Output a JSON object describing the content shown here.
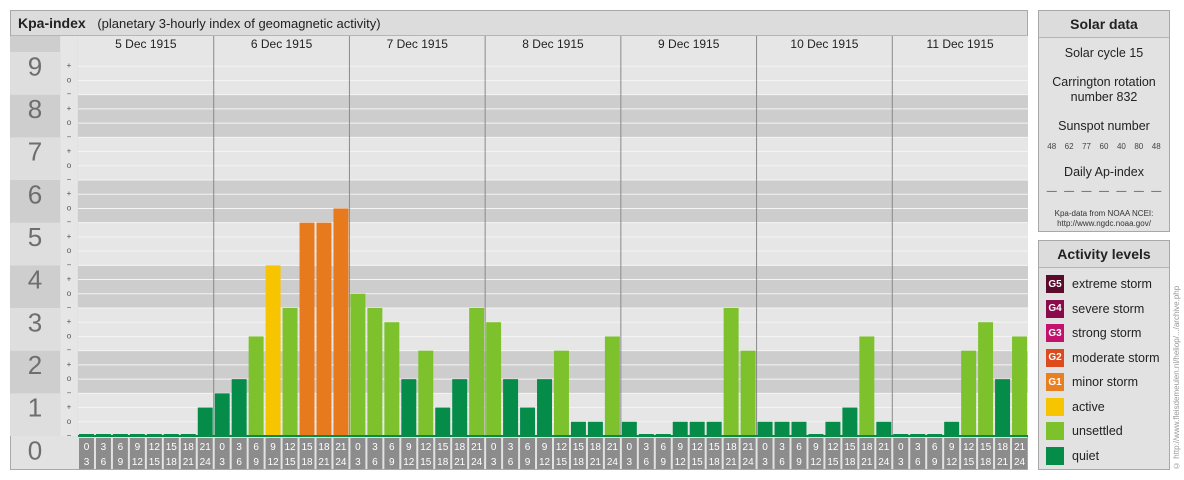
{
  "header": {
    "title": "Kpa-index",
    "subtitle": "(planetary 3-hourly index of geomagnetic activity)"
  },
  "chart_data": {
    "type": "bar",
    "ylim": [
      0,
      9
    ],
    "y_ticks": [
      "0",
      "1",
      "2",
      "3",
      "4",
      "5",
      "6",
      "7",
      "8",
      "9"
    ],
    "sub_ticks": [
      "−",
      "o",
      "+"
    ],
    "days": [
      "5 Dec 1915",
      "6 Dec 1915",
      "7 Dec 1915",
      "8 Dec 1915",
      "9 Dec 1915",
      "10 Dec 1915",
      "11 Dec 1915"
    ],
    "interval_starts": [
      "0",
      "3",
      "6",
      "9",
      "12",
      "15",
      "18",
      "21"
    ],
    "interval_ends": [
      "3",
      "6",
      "9",
      "12",
      "15",
      "18",
      "21",
      "24"
    ],
    "values": [
      0,
      0,
      0,
      0,
      0,
      0,
      0,
      0.667,
      1,
      1.333,
      2.333,
      4,
      3,
      5,
      5,
      5.333,
      3.333,
      3,
      2.667,
      1.333,
      2,
      0.667,
      1.333,
      3,
      2.667,
      1.333,
      0.667,
      1.333,
      2,
      0.333,
      0.333,
      2.333,
      0.333,
      0,
      0,
      0.333,
      0.333,
      0.333,
      3,
      2,
      0.333,
      0.333,
      0.333,
      0,
      0.333,
      0.667,
      2.333,
      0.333,
      0,
      0,
      0,
      0.333,
      2,
      2.667,
      1.333,
      2.333
    ]
  },
  "solar": {
    "title": "Solar data",
    "cycle": "Solar cycle 15",
    "carrington_1": "Carrington rotation",
    "carrington_2": "number 832",
    "sunspot_title": "Sunspot number",
    "sunspots": [
      "48",
      "62",
      "77",
      "60",
      "40",
      "80",
      "48"
    ],
    "ap_title": "Daily Ap-index",
    "ap_values": [
      "—",
      "—",
      "—",
      "—",
      "—",
      "—",
      "—"
    ],
    "credit_1": "Kpa-data from NOAA NCEI:",
    "credit_2": "http://www.ngdc.noaa.gov/"
  },
  "levels": {
    "title": "Activity levels",
    "items": [
      {
        "badge": "G5",
        "label": "extreme storm",
        "color": "#5a0a2a"
      },
      {
        "badge": "G4",
        "label": "severe storm",
        "color": "#8a0b4c"
      },
      {
        "badge": "G3",
        "label": "strong storm",
        "color": "#c2126e"
      },
      {
        "badge": "G2",
        "label": "moderate storm",
        "color": "#dc4a1d"
      },
      {
        "badge": "G1",
        "label": "minor storm",
        "color": "#e88021"
      },
      {
        "badge": "",
        "label": "active",
        "color": "#f7c400"
      },
      {
        "badge": "",
        "label": "unsettled",
        "color": "#7dc22d"
      },
      {
        "badge": "",
        "label": "quiet",
        "color": "#058c48"
      }
    ]
  },
  "vertical_credit": "© http://www.fleisdemeulen.nl/heliop/.../archive.php"
}
